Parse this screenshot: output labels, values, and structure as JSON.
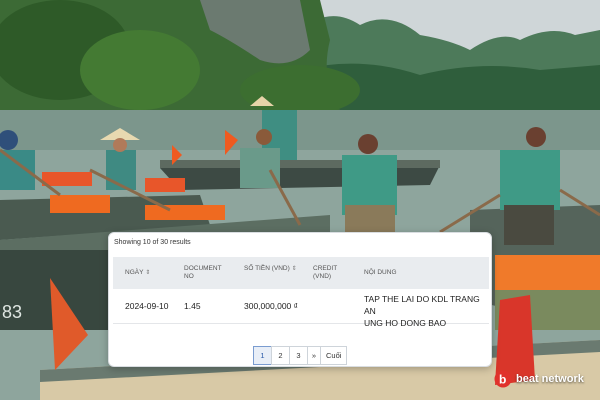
{
  "results": {
    "summary": "Showing 10 of 30 results"
  },
  "table": {
    "headers": {
      "date": "NGÀY",
      "document_no": [
        "DOCUMENT",
        "NO"
      ],
      "amount": [
        "SỐ TIỀN (VND)"
      ],
      "credit": [
        "CREDIT",
        "(VND)"
      ],
      "content": "NỘI DUNG"
    },
    "rows": [
      {
        "date": "2024-09-10",
        "document_no": "1.45",
        "amount": "300,000,000 ₫",
        "credit": "",
        "content_lines": [
          "TAP THE LAI DO KDL TRANG AN",
          "UNG HO DONG BAO"
        ]
      }
    ]
  },
  "pagination": {
    "pages": [
      "1",
      "2",
      "3"
    ],
    "active_page": "1",
    "next": "»",
    "last": "Cuối"
  },
  "watermark": {
    "brand": "beat network",
    "mark": "b"
  },
  "colors": {
    "accent_red": "#e0322c",
    "page_active": "#2b5aa8"
  }
}
